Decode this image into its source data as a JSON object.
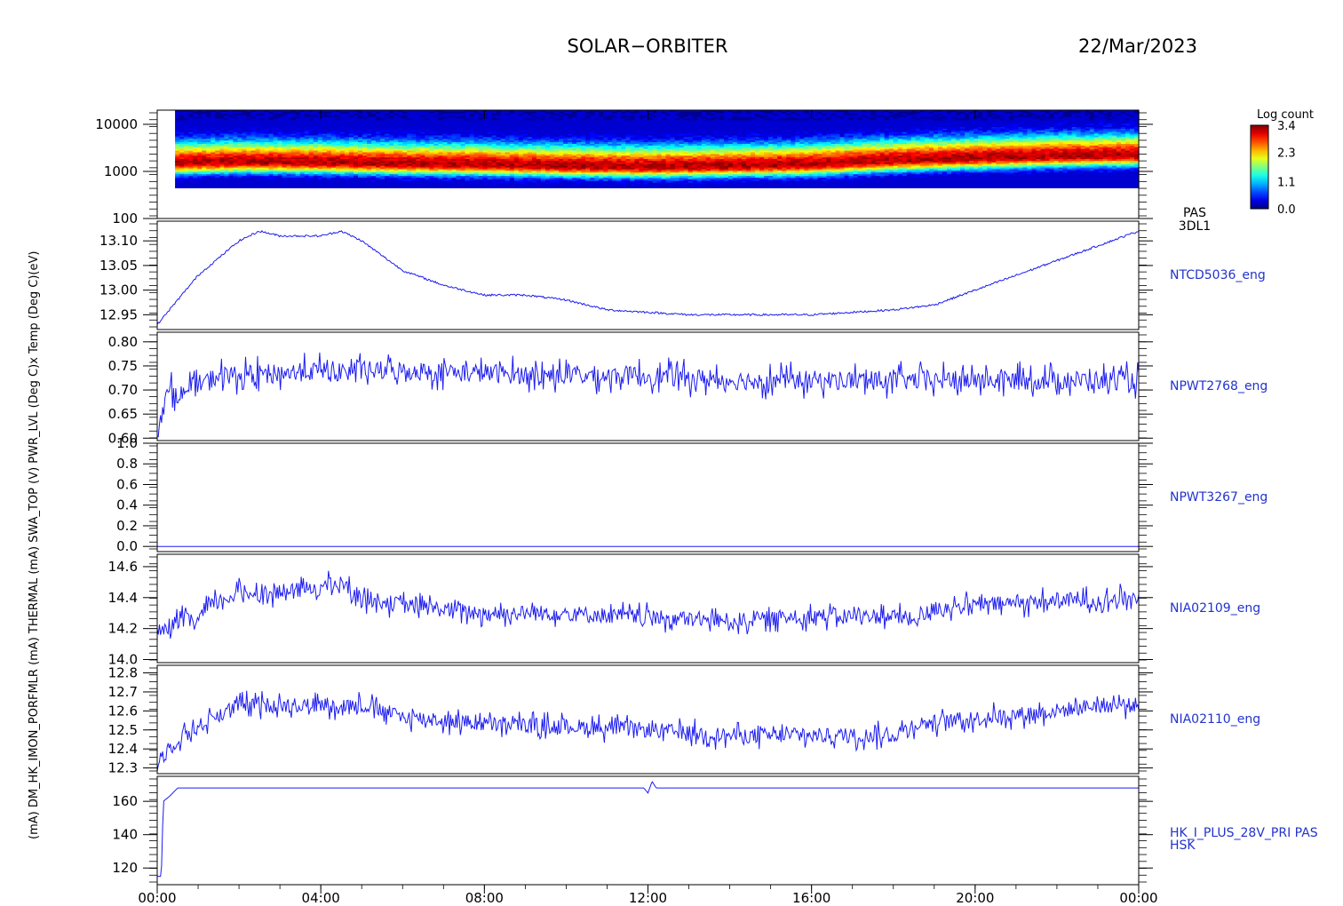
{
  "header": {
    "title": "SOLAR−ORBITER",
    "date": "22/Mar/2023"
  },
  "colorbar": {
    "label": "Log count",
    "ticks": [
      "3.4",
      "2.3",
      "1.1",
      "0.0"
    ],
    "range": [
      0.0,
      3.4
    ]
  },
  "chart_data": [
    {
      "type": "heatmap",
      "panel": "spectrogram",
      "ylabel": "(eV)",
      "yscale": "log",
      "ylim": [
        100,
        20000
      ],
      "yticks": [
        "10000",
        "1000",
        "100"
      ],
      "xlim_hours": [
        0,
        24
      ],
      "right_label": [
        "PAS",
        "3DL1"
      ],
      "peak_energy_ev_by_hour": [
        [
          0.5,
          1500
        ],
        [
          2,
          1600
        ],
        [
          4,
          1550
        ],
        [
          6,
          1450
        ],
        [
          8,
          1400
        ],
        [
          10,
          1300
        ],
        [
          12,
          1250
        ],
        [
          14,
          1300
        ],
        [
          16,
          1400
        ],
        [
          18,
          1700
        ],
        [
          20,
          1900
        ],
        [
          22,
          2100
        ],
        [
          24,
          2200
        ]
      ]
    },
    {
      "type": "line",
      "panel": "ntcd5036",
      "ylabel": "x Temp (Deg C)",
      "ylim": [
        12.92,
        13.14
      ],
      "yticks": [
        "13.10",
        "13.05",
        "13.00",
        "12.95"
      ],
      "right_label": "NTCD5036_eng",
      "x_hours": [
        0,
        1,
        2,
        2.5,
        3,
        4,
        4.5,
        5,
        6,
        7,
        8,
        9,
        10,
        11,
        12,
        13,
        14,
        15,
        16,
        17,
        18,
        19,
        20,
        21,
        22,
        23,
        24
      ],
      "y": [
        12.93,
        13.03,
        13.1,
        13.12,
        13.11,
        13.11,
        13.12,
        13.1,
        13.04,
        13.01,
        12.99,
        12.99,
        12.98,
        12.96,
        12.955,
        12.95,
        12.95,
        12.95,
        12.95,
        12.955,
        12.96,
        12.97,
        13.0,
        13.03,
        13.06,
        13.09,
        13.12
      ]
    },
    {
      "type": "line",
      "panel": "npwt2768",
      "ylabel": "(V)",
      "ylim": [
        0.595,
        0.82
      ],
      "yticks": [
        "0.80",
        "0.75",
        "0.70",
        "0.65",
        "0.60"
      ],
      "right_label": "NPWT2768_eng",
      "x_hours": [
        0,
        0.1,
        0.3,
        0.6,
        1,
        1.5,
        2,
        4,
        6,
        8,
        10,
        12,
        14,
        16,
        18,
        20,
        22,
        24
      ],
      "y": [
        0.62,
        0.65,
        0.7,
        0.69,
        0.71,
        0.73,
        0.73,
        0.74,
        0.74,
        0.735,
        0.73,
        0.73,
        0.72,
        0.72,
        0.72,
        0.72,
        0.72,
        0.72
      ],
      "noise_amplitude": 0.04
    },
    {
      "type": "line",
      "panel": "npwt3267",
      "ylabel": "",
      "ylim": [
        -0.05,
        1.0
      ],
      "yticks": [
        "1.0",
        "0.8",
        "0.6",
        "0.4",
        "0.2",
        "0.0"
      ],
      "right_label": "NPWT3267_eng",
      "x_hours": [
        0,
        24
      ],
      "y": [
        0.0,
        0.0
      ]
    },
    {
      "type": "line",
      "panel": "nia02109",
      "ylabel": "(mA)",
      "ylim": [
        13.98,
        14.68
      ],
      "yticks": [
        "14.6",
        "14.4",
        "14.2",
        "14.0"
      ],
      "right_label": "NIA02109_eng",
      "x_hours": [
        0,
        0.4,
        0.5,
        1,
        1.3,
        2,
        3,
        4,
        4.5,
        5,
        6,
        8,
        10,
        12,
        14,
        16,
        18,
        18.5,
        19,
        20,
        22,
        23,
        24
      ],
      "y": [
        14.18,
        14.18,
        14.25,
        14.25,
        14.35,
        14.43,
        14.43,
        14.47,
        14.49,
        14.4,
        14.35,
        14.3,
        14.3,
        14.27,
        14.25,
        14.28,
        14.28,
        14.25,
        14.33,
        14.35,
        14.38,
        14.38,
        14.4
      ],
      "noise_amplitude": 0.1
    },
    {
      "type": "line",
      "panel": "nia02110",
      "ylabel": "(mA)",
      "ylim": [
        12.27,
        12.84
      ],
      "yticks": [
        "12.8",
        "12.7",
        "12.6",
        "12.5",
        "12.4",
        "12.3"
      ],
      "right_label": "NIA02110_eng",
      "x_hours": [
        0,
        0.3,
        0.6,
        1.2,
        1.5,
        2,
        4,
        5,
        6,
        8,
        10,
        12,
        14,
        16,
        18,
        18.5,
        20,
        22,
        23,
        24
      ],
      "y": [
        12.33,
        12.4,
        12.47,
        12.54,
        12.58,
        12.63,
        12.63,
        12.63,
        12.57,
        12.53,
        12.52,
        12.5,
        12.47,
        12.47,
        12.47,
        12.53,
        12.56,
        12.6,
        12.63,
        12.63
      ],
      "noise_amplitude": 0.08
    },
    {
      "type": "line",
      "panel": "hk_i_plus",
      "ylabel": "(mA)",
      "ylim": [
        110,
        175
      ],
      "yticks": [
        "160",
        "140",
        "120"
      ],
      "right_label": [
        "HK_I_PLUS_28V_PRI PAS",
        "HSK"
      ],
      "x_hours": [
        0,
        0.1,
        0.15,
        0.3,
        0.5,
        1,
        11.9,
        12.0,
        12.1,
        12.2,
        24
      ],
      "y": [
        115,
        115,
        160,
        163,
        168,
        168,
        168,
        165,
        172,
        168,
        168
      ]
    }
  ],
  "xaxis": {
    "ticks": [
      "00:00",
      "04:00",
      "08:00",
      "12:00",
      "16:00",
      "20:00",
      "00:00"
    ]
  },
  "left_axis_caption": "(mA) DM_HK_IMON_PORFMLR (mA) THERMAL (mA) SWA_TOP (V) PWR_LVL (Deg C)x Temp (Deg C)(eV)"
}
